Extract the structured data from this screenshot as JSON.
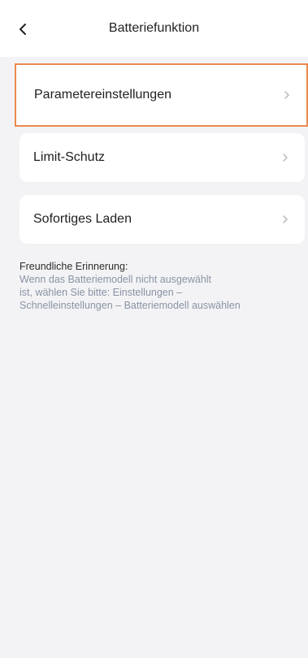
{
  "header": {
    "title": "Batteriefunktion",
    "back_icon": "chevron-left-icon"
  },
  "menu": {
    "items": [
      {
        "label": "Parametereinstellungen",
        "icon": "chevron-right-icon",
        "selected": true
      },
      {
        "label": "Limit-Schutz",
        "icon": "chevron-right-icon",
        "selected": false
      },
      {
        "label": "Sofortiges Laden",
        "icon": "chevron-right-icon",
        "selected": false
      }
    ]
  },
  "reminder": {
    "title": "Freundliche Erinnerung:",
    "lines": [
      "Wenn das Batteriemodell nicht ausgewählt",
      "ist, wählen Sie bitte: Einstellungen –",
      "Schnelleinstellungen – Batteriemodell auswählen"
    ]
  },
  "colors": {
    "highlight_border": "#ec8a4e",
    "background": "#f3f3f5",
    "reminder_text": "#8a93a6"
  }
}
